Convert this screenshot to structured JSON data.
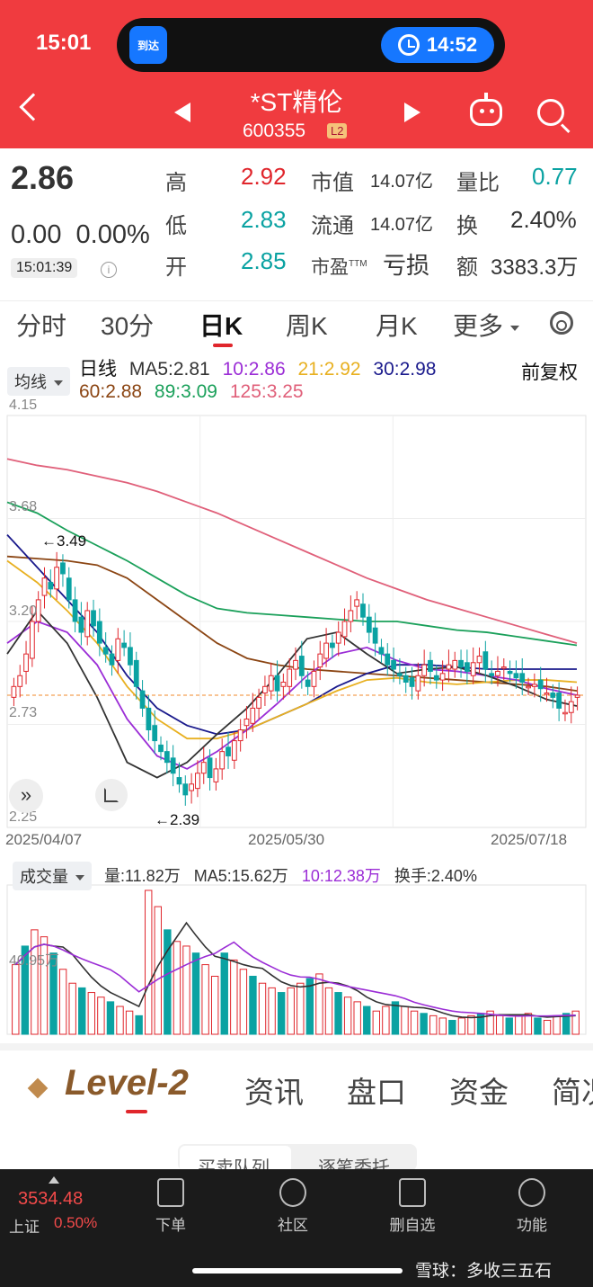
{
  "status_bar": {
    "time": "15:01",
    "island_app": "到达",
    "island_time": "14:52"
  },
  "header": {
    "stock_name": "*ST精伦",
    "stock_code": "600355",
    "badge": "L2"
  },
  "quote": {
    "price": "2.86",
    "change": "0.00",
    "change_pct": "0.00%",
    "time": "15:01:39",
    "high_label": "高",
    "high": "2.92",
    "low_label": "低",
    "low": "2.83",
    "open_label": "开",
    "open": "2.85",
    "mktcap_label": "市值",
    "mktcap": "14.07亿",
    "float_label": "流通",
    "float": "14.07亿",
    "pe_label": "市盈",
    "pe_sup": "TTM",
    "pe": "亏损",
    "vol_ratio_label": "量比",
    "vol_ratio": "0.77",
    "turnover_label": "换",
    "turnover": "2.40%",
    "amount_label": "额",
    "amount": "3383.3万"
  },
  "tabs": [
    "分时",
    "30分",
    "日K",
    "周K",
    "月K",
    "更多"
  ],
  "kline": {
    "indicator_btn": "均线",
    "period": "日线",
    "ma5": "MA5:2.81",
    "ma10": "10:2.86",
    "ma21": "21:2.92",
    "ma30": "30:2.98",
    "ma60": "60:2.88",
    "ma89": "89:3.09",
    "ma125": "125:3.25",
    "adjust": "前复权",
    "colors": {
      "ma5": "#333333",
      "ma10": "#9b2dd6",
      "ma21": "#e8b020",
      "ma30": "#1a1a8c",
      "ma60": "#8b4513",
      "ma89": "#1aa05a",
      "ma125": "#e0607a"
    }
  },
  "chart_data": {
    "type": "candlestick",
    "y_ticks": [
      "4.15",
      "3.68",
      "3.20",
      "2.73",
      "2.25"
    ],
    "x_labels": [
      "2025/04/07",
      "2025/05/30",
      "2025/07/18"
    ],
    "ylim": [
      2.25,
      4.15
    ],
    "high_annotation": "←3.49",
    "low_annotation": "←2.39",
    "current_price": 2.86,
    "closes": [
      2.9,
      2.95,
      3.05,
      3.2,
      3.3,
      3.4,
      3.35,
      3.45,
      3.42,
      3.3,
      3.2,
      3.15,
      3.25,
      3.18,
      3.1,
      3.05,
      3.0,
      3.12,
      3.08,
      3.0,
      2.9,
      2.8,
      2.7,
      2.65,
      2.6,
      2.55,
      2.5,
      2.45,
      2.4,
      2.45,
      2.5,
      2.55,
      2.48,
      2.52,
      2.6,
      2.58,
      2.65,
      2.7,
      2.75,
      2.8,
      2.85,
      2.9,
      2.95,
      2.88,
      2.92,
      2.98,
      3.02,
      2.95,
      2.9,
      2.97,
      3.05,
      3.1,
      3.08,
      3.15,
      3.2,
      3.25,
      3.3,
      3.22,
      3.15,
      3.1,
      3.05,
      3.0,
      2.98,
      2.95,
      2.92,
      2.9,
      2.95,
      3.0,
      2.97,
      2.93,
      2.96,
      3.0,
      3.02,
      2.99,
      2.97,
      3.01,
      3.04,
      2.98,
      2.95,
      2.97,
      2.99,
      2.96,
      2.94,
      2.92,
      2.9,
      2.91,
      2.89,
      2.87,
      2.85,
      2.8,
      2.78,
      2.83,
      2.86
    ],
    "ma_series": {
      "ma125": [
        3.95,
        3.92,
        3.9,
        3.87,
        3.84,
        3.8,
        3.75,
        3.7,
        3.64,
        3.58,
        3.52,
        3.46,
        3.4,
        3.35,
        3.3,
        3.26,
        3.22,
        3.18,
        3.14,
        3.1
      ],
      "ma89": [
        3.75,
        3.7,
        3.62,
        3.55,
        3.48,
        3.4,
        3.32,
        3.26,
        3.24,
        3.23,
        3.22,
        3.21,
        3.2,
        3.2,
        3.18,
        3.16,
        3.15,
        3.13,
        3.11,
        3.09
      ],
      "ma60": [
        3.5,
        3.49,
        3.48,
        3.46,
        3.4,
        3.3,
        3.2,
        3.1,
        3.03,
        3.0,
        2.98,
        2.97,
        2.96,
        2.95,
        2.94,
        2.93,
        2.92,
        2.91,
        2.9,
        2.88
      ],
      "ma30": [
        3.6,
        3.45,
        3.3,
        3.15,
        2.95,
        2.8,
        2.72,
        2.68,
        2.7,
        2.76,
        2.82,
        2.9,
        2.96,
        3.0,
        3.0,
        2.99,
        2.98,
        2.98,
        2.98,
        2.98
      ],
      "ma21": [
        3.48,
        3.38,
        3.25,
        3.1,
        2.9,
        2.75,
        2.66,
        2.66,
        2.7,
        2.76,
        2.82,
        2.88,
        2.93,
        2.94,
        2.92,
        2.91,
        2.92,
        2.93,
        2.93,
        2.92
      ],
      "ma10": [
        3.1,
        3.2,
        3.15,
        3.0,
        2.75,
        2.58,
        2.52,
        2.6,
        2.7,
        2.82,
        2.95,
        3.05,
        3.08,
        3.02,
        2.98,
        2.97,
        2.95,
        2.93,
        2.89,
        2.86
      ],
      "ma5": [
        3.05,
        3.25,
        3.1,
        2.85,
        2.55,
        2.48,
        2.55,
        2.68,
        2.8,
        2.95,
        3.12,
        3.15,
        3.05,
        2.96,
        2.98,
        2.99,
        2.95,
        2.9,
        2.84,
        2.81
      ]
    },
    "volume": {
      "indicator_btn": "成交量",
      "vol": "量:11.82万",
      "ma5": "MA5:15.62万",
      "ma10": "10:12.38万",
      "turnover": "换手:2.40%",
      "y_tick": "40.95万",
      "values": [
        30,
        38,
        45,
        42,
        35,
        28,
        22,
        20,
        18,
        16,
        14,
        12,
        10,
        8,
        62,
        55,
        45,
        40,
        38,
        35,
        30,
        25,
        35,
        32,
        28,
        25,
        22,
        20,
        18,
        20,
        22,
        24,
        26,
        20,
        18,
        16,
        14,
        12,
        10,
        12,
        14,
        12,
        10,
        9,
        8,
        7,
        6,
        7,
        8,
        9,
        10,
        8,
        7,
        8,
        9,
        7,
        6,
        8,
        9,
        10
      ]
    }
  },
  "lower_section": {
    "level2": "Level-2",
    "tabs": [
      "资讯",
      "盘口",
      "资金",
      "简况"
    ],
    "sub_tabs": [
      "买卖队列",
      "逐笔委托"
    ]
  },
  "footer": {
    "index_value": "3534.48",
    "index_name": "上证",
    "index_pct": "0.50%",
    "items": [
      "下单",
      "社区",
      "删自选",
      "功能"
    ],
    "watermark": "雪球：多收三五石"
  }
}
